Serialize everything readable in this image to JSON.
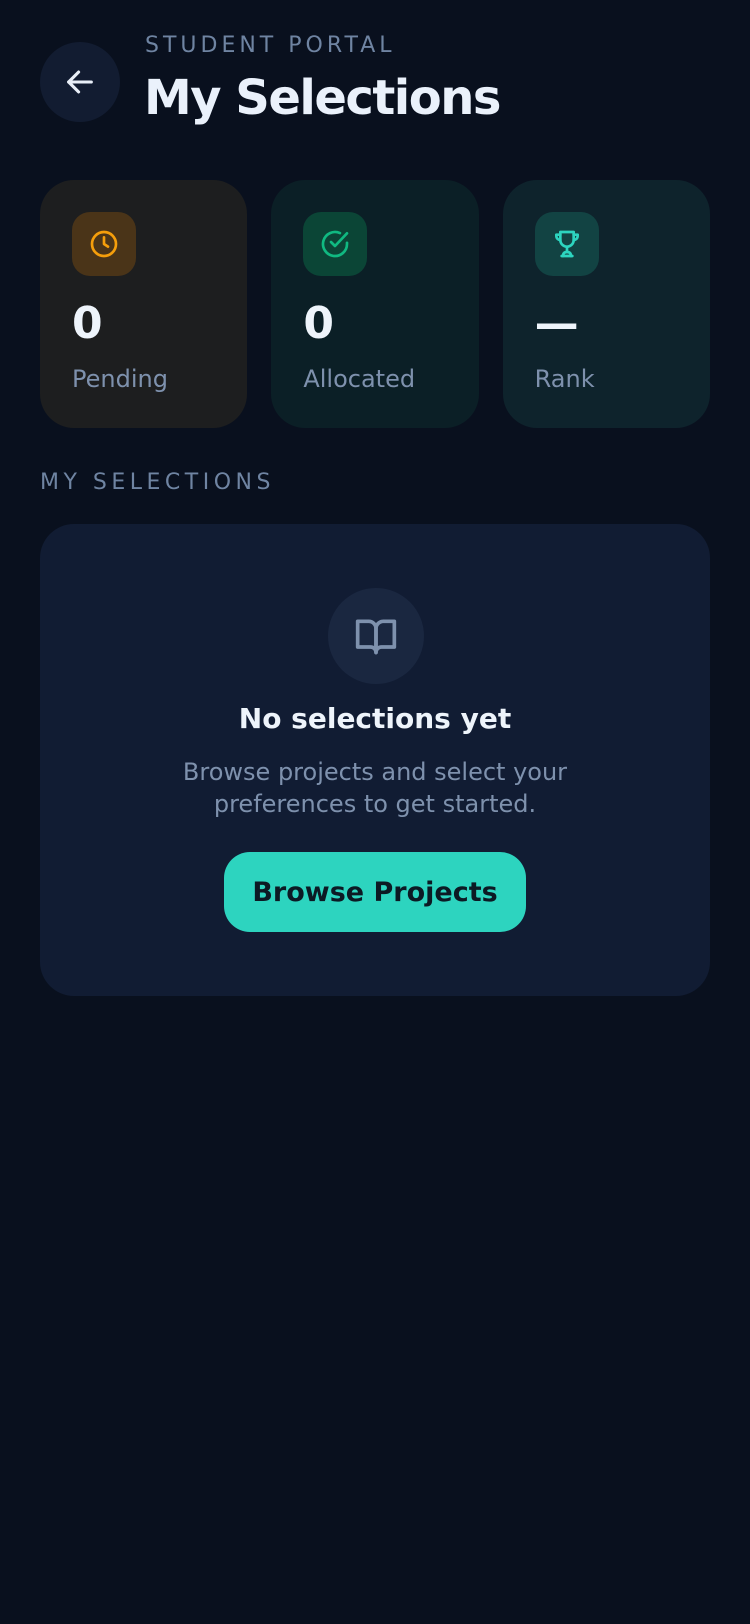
{
  "header": {
    "eyebrow": "STUDENT PORTAL",
    "title": "My Selections",
    "back_icon": "arrow-left-icon"
  },
  "stats": [
    {
      "icon": "clock-icon",
      "value": "0",
      "label": "Pending",
      "accent": "#f59e0b"
    },
    {
      "icon": "check-circle-icon",
      "value": "0",
      "label": "Allocated",
      "accent": "#10b981"
    },
    {
      "icon": "trophy-icon",
      "value": "—",
      "label": "Rank",
      "accent": "#2dd4bf"
    }
  ],
  "section": {
    "heading": "MY SELECTIONS"
  },
  "empty_state": {
    "icon": "book-open-icon",
    "title": "No selections yet",
    "text": "Browse projects and select your preferences to get started.",
    "button_label": "Browse Projects"
  },
  "colors": {
    "background": "#09101e",
    "card": "#111c33",
    "primary": "#2dd4bf",
    "muted_text": "#7e91ad"
  }
}
